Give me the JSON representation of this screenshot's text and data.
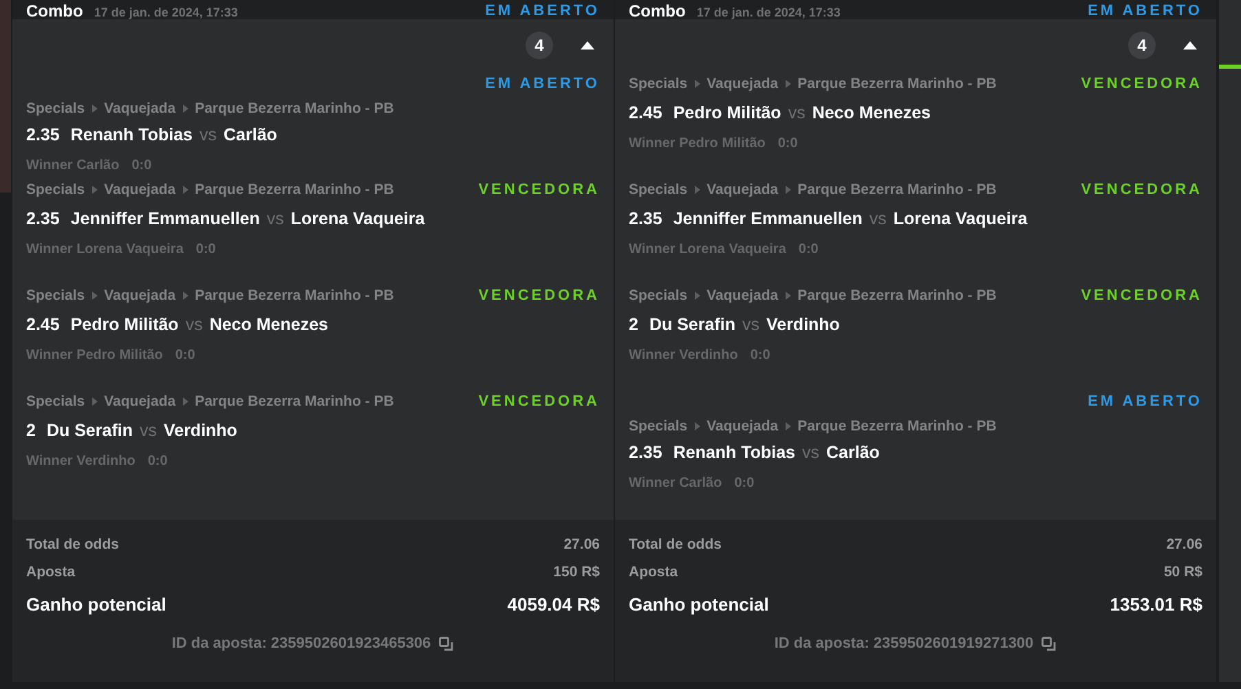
{
  "bets": [
    {
      "header": {
        "title": "Combo",
        "date": "17 de jan. de 2024, 17:33",
        "status": {
          "kind": "open",
          "label": "EM ABERTO"
        }
      },
      "count": "4",
      "expanded": true,
      "selections": [
        {
          "status": {
            "kind": "open",
            "label": "EM ABERTO"
          },
          "path": [
            "Specials",
            "Vaquejada",
            "Parque Bezerra Marinho - PB"
          ],
          "odds": "2.35",
          "home": "Renanh Tobias",
          "vs": "vs",
          "away": "Carlão",
          "market": "Winner Carlão",
          "score": "0:0"
        },
        {
          "status": {
            "kind": "won",
            "label": "VENCEDORA"
          },
          "path": [
            "Specials",
            "Vaquejada",
            "Parque Bezerra Marinho - PB"
          ],
          "odds": "2.35",
          "home": "Jenniffer Emmanuellen",
          "vs": "vs",
          "away": "Lorena Vaqueira",
          "market": "Winner Lorena Vaqueira",
          "score": "0:0"
        },
        {
          "status": {
            "kind": "won",
            "label": "VENCEDORA"
          },
          "path": [
            "Specials",
            "Vaquejada",
            "Parque Bezerra Marinho - PB"
          ],
          "odds": "2.45",
          "home": "Pedro Militão",
          "vs": "vs",
          "away": "Neco Menezes",
          "market": "Winner Pedro Militão",
          "score": "0:0"
        },
        {
          "status": {
            "kind": "won",
            "label": "VENCEDORA"
          },
          "path": [
            "Specials",
            "Vaquejada",
            "Parque Bezerra Marinho - PB"
          ],
          "odds": "2",
          "home": "Du Serafin",
          "vs": "vs",
          "away": "Verdinho",
          "market": "Winner Verdinho",
          "score": "0:0"
        }
      ],
      "summary": [
        {
          "kind": "minor",
          "label": "Total de odds",
          "value": "27.06"
        },
        {
          "kind": "minor",
          "label": "Aposta",
          "value": "150 R$"
        },
        {
          "kind": "major",
          "label": "Ganho potencial",
          "value": "4059.04 R$"
        }
      ],
      "bet_id": "ID da aposta: 2359502601923465306"
    },
    {
      "header": {
        "title": "Combo",
        "date": "17 de jan. de 2024, 17:33",
        "status": {
          "kind": "open",
          "label": "EM ABERTO"
        }
      },
      "count": "4",
      "expanded": true,
      "selections": [
        {
          "status": {
            "kind": "won",
            "label": "VENCEDORA"
          },
          "path": [
            "Specials",
            "Vaquejada",
            "Parque Bezerra Marinho - PB"
          ],
          "odds": "2.45",
          "home": "Pedro Militão",
          "vs": "vs",
          "away": "Neco Menezes",
          "market": "Winner Pedro Militão",
          "score": "0:0"
        },
        {
          "status": {
            "kind": "won",
            "label": "VENCEDORA"
          },
          "path": [
            "Specials",
            "Vaquejada",
            "Parque Bezerra Marinho - PB"
          ],
          "odds": "2.35",
          "home": "Jenniffer Emmanuellen",
          "vs": "vs",
          "away": "Lorena Vaqueira",
          "market": "Winner Lorena Vaqueira",
          "score": "0:0"
        },
        {
          "status": {
            "kind": "won",
            "label": "VENCEDORA"
          },
          "path": [
            "Specials",
            "Vaquejada",
            "Parque Bezerra Marinho - PB"
          ],
          "odds": "2",
          "home": "Du Serafin",
          "vs": "vs",
          "away": "Verdinho",
          "market": "Winner Verdinho",
          "score": "0:0"
        },
        {
          "status": {
            "kind": "open",
            "label": "EM ABERTO"
          },
          "path": [
            "Specials",
            "Vaquejada",
            "Parque Bezerra Marinho - PB"
          ],
          "odds": "2.35",
          "home": "Renanh Tobias",
          "vs": "vs",
          "away": "Carlão",
          "market": "Winner Carlão",
          "score": "0:0"
        }
      ],
      "summary": [
        {
          "kind": "minor",
          "label": "Total de odds",
          "value": "27.06"
        },
        {
          "kind": "minor",
          "label": "Aposta",
          "value": "50 R$"
        },
        {
          "kind": "major",
          "label": "Ganho potencial",
          "value": "1353.01 R$"
        }
      ],
      "bet_id": "ID da aposta: 2359502601919271300"
    }
  ]
}
